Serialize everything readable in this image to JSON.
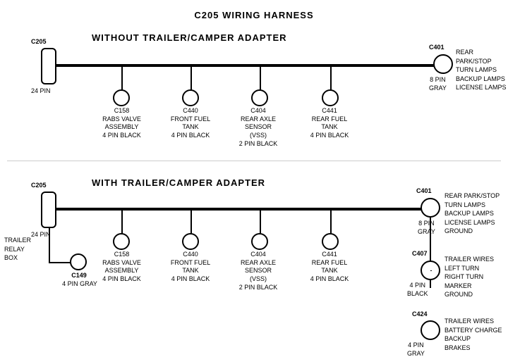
{
  "title": "C205 WIRING HARNESS",
  "section1": {
    "label": "WITHOUT  TRAILER/CAMPER ADAPTER",
    "connectors": [
      {
        "id": "C205_1",
        "label": "C205",
        "sublabel": "24 PIN",
        "type": "rect"
      },
      {
        "id": "C401_1",
        "label": "C401",
        "sublabel": "8 PIN\nGRAY",
        "type": "circle"
      },
      {
        "id": "C158_1",
        "label": "C158",
        "sublabel": "RABS VALVE\nASSEMBLY\n4 PIN BLACK"
      },
      {
        "id": "C440_1",
        "label": "C440",
        "sublabel": "FRONT FUEL\nTANK\n4 PIN BLACK"
      },
      {
        "id": "C404_1",
        "label": "C404",
        "sublabel": "REAR AXLE\nSENSOR\n(VSS)\n2 PIN BLACK"
      },
      {
        "id": "C441_1",
        "label": "C441",
        "sublabel": "REAR FUEL\nTANK\n4 PIN BLACK"
      }
    ],
    "right_label": "REAR PARK/STOP\nTURN LAMPS\nBACKUP LAMPS\nLICENSE LAMPS"
  },
  "section2": {
    "label": "WITH TRAILER/CAMPER ADAPTER",
    "connectors": [
      {
        "id": "C205_2",
        "label": "C205",
        "sublabel": "24 PIN",
        "type": "rect"
      },
      {
        "id": "C401_2",
        "label": "C401",
        "sublabel": "8 PIN\nGRAY",
        "type": "circle"
      },
      {
        "id": "C158_2",
        "label": "C158",
        "sublabel": "RABS VALVE\nASSEMBLY\n4 PIN BLACK"
      },
      {
        "id": "C440_2",
        "label": "C440",
        "sublabel": "FRONT FUEL\nTANK\n4 PIN BLACK"
      },
      {
        "id": "C404_2",
        "label": "C404",
        "sublabel": "REAR AXLE\nSENSOR\n(VSS)\n2 PIN BLACK"
      },
      {
        "id": "C441_2",
        "label": "C441",
        "sublabel": "REAR FUEL\nTANK\n4 PIN BLACK"
      },
      {
        "id": "C149",
        "label": "C149",
        "sublabel": "4 PIN GRAY"
      },
      {
        "id": "C407",
        "label": "C407",
        "sublabel": "4 PIN\nBLACK"
      },
      {
        "id": "C424",
        "label": "C424",
        "sublabel": "4 PIN\nGRAY"
      }
    ],
    "right_label1": "REAR PARK/STOP\nTURN LAMPS\nBACKUP LAMPS\nLICENSE LAMPS\nGROUND",
    "right_label2": "TRAILER WIRES\nLEFT TURN\nRIGHT TURN\nMARKER\nGROUND",
    "right_label3": "TRAILER WIRES\nBATTERY CHARGE\nBACKUP\nBRAKES",
    "trailer_relay": "TRAILER\nRELAY\nBOX"
  }
}
